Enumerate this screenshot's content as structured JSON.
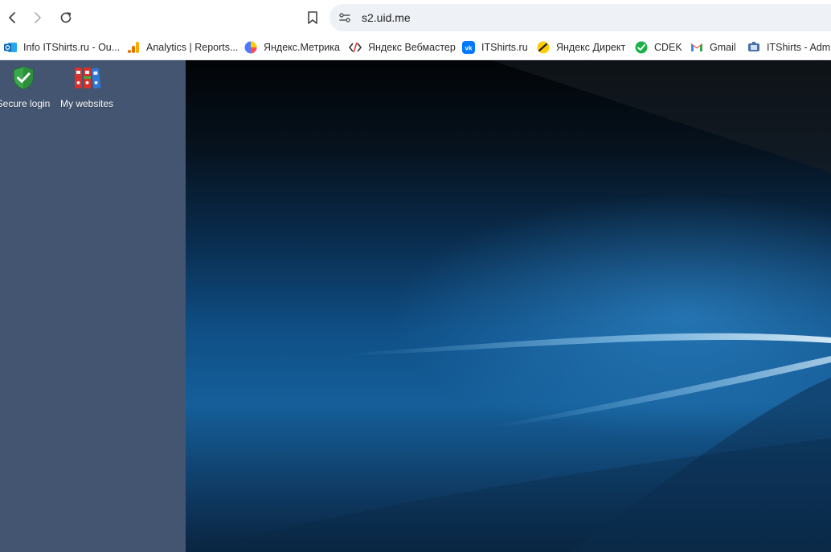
{
  "browser": {
    "url": "s2.uid.me"
  },
  "bookmarks": [
    {
      "label": "Info ITShirts.ru - Ou...",
      "icon": "outlook-icon"
    },
    {
      "label": "Analytics | Reports...",
      "icon": "analytics-icon"
    },
    {
      "label": "Яндекс.Метрика",
      "icon": "yandex-metrika-icon"
    },
    {
      "label": "Яндекс Вебмастер",
      "icon": "yandex-webmaster-icon"
    },
    {
      "label": "ITShirts.ru",
      "icon": "vk-icon"
    },
    {
      "label": "Яндекс Директ",
      "icon": "yandex-direct-icon"
    },
    {
      "label": "CDEK",
      "icon": "cdek-icon"
    },
    {
      "label": "Gmail",
      "icon": "gmail-icon"
    },
    {
      "label": "ITShirts - Admi",
      "icon": "admin-icon"
    }
  ],
  "desktop": {
    "icons": [
      {
        "label": "Secure login",
        "icon": "shield-check-icon"
      },
      {
        "label": "My websites",
        "icon": "binders-icon"
      }
    ]
  },
  "colors": {
    "sidebar": "#435571",
    "desktop_dark": "#020406",
    "desktop_blue": "#155f9a"
  }
}
